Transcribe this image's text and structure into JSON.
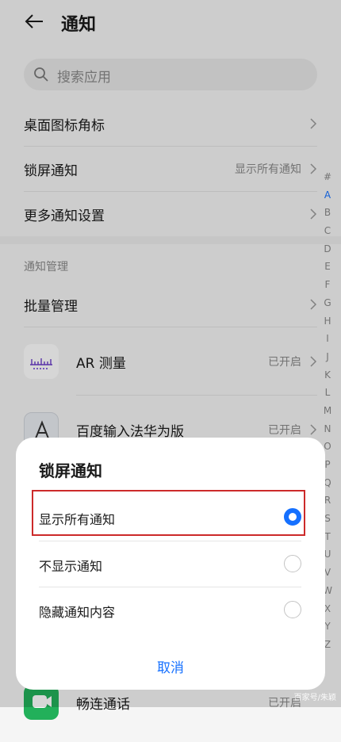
{
  "header": {
    "title": "通知"
  },
  "search": {
    "placeholder": "搜索应用"
  },
  "rows": [
    {
      "label": "桌面图标角标",
      "value": ""
    },
    {
      "label": "锁屏通知",
      "value": "显示所有通知"
    },
    {
      "label": "更多通知设置",
      "value": ""
    }
  ],
  "section": {
    "title": "通知管理"
  },
  "batch": {
    "label": "批量管理"
  },
  "apps": [
    {
      "name": "AR 测量",
      "status": "已开启"
    },
    {
      "name": "百度输入法华为版",
      "status": "已开启"
    },
    {
      "name": "畅连通话",
      "status": "已开启"
    }
  ],
  "alphabet": [
    "#",
    "A",
    "B",
    "C",
    "D",
    "E",
    "F",
    "G",
    "H",
    "I",
    "J",
    "K",
    "L",
    "M",
    "N",
    "O",
    "P",
    "Q",
    "R",
    "S",
    "T",
    "U",
    "V",
    "W",
    "X",
    "Y",
    "Z"
  ],
  "alphabet_active": "A",
  "dialog": {
    "title": "锁屏通知",
    "options": [
      "显示所有通知",
      "不显示通知",
      "隐藏通知内容"
    ],
    "selected_index": 0,
    "cancel": "取消"
  },
  "watermark": "百家号/朱颖",
  "colors": {
    "accent": "#1570ff",
    "highlight": "#cc2a2a"
  }
}
